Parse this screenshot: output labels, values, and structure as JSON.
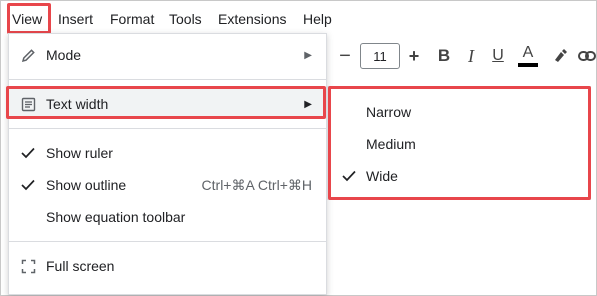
{
  "menubar": {
    "items": [
      {
        "label": "View"
      },
      {
        "label": "Insert"
      },
      {
        "label": "Format"
      },
      {
        "label": "Tools"
      },
      {
        "label": "Extensions"
      },
      {
        "label": "Help"
      }
    ]
  },
  "toolbar": {
    "font_size_decrease": "−",
    "font_size": "11",
    "font_size_increase": "+",
    "bold": "B",
    "italic": "I",
    "underline": "U",
    "text_color": "A",
    "text_color_value": "#000000"
  },
  "view_menu": {
    "items": [
      {
        "label": "Mode",
        "icon": "pencil-icon",
        "has_submenu": true
      },
      {
        "label": "Text width",
        "icon": "text-width-icon",
        "has_submenu": true,
        "highlighted": true
      },
      {
        "label": "Show ruler",
        "checked": true
      },
      {
        "label": "Show outline",
        "checked": true,
        "shortcut": "Ctrl+⌘A Ctrl+⌘H"
      },
      {
        "label": "Show equation toolbar",
        "checked": false
      },
      {
        "label": "Full screen",
        "icon": "fullscreen-icon"
      }
    ]
  },
  "text_width_submenu": {
    "items": [
      {
        "label": "Narrow",
        "checked": false
      },
      {
        "label": "Medium",
        "checked": false
      },
      {
        "label": "Wide",
        "checked": true
      }
    ]
  },
  "colors": {
    "highlight_border": "#e8464b",
    "hover_bg": "#f1f3f4"
  }
}
